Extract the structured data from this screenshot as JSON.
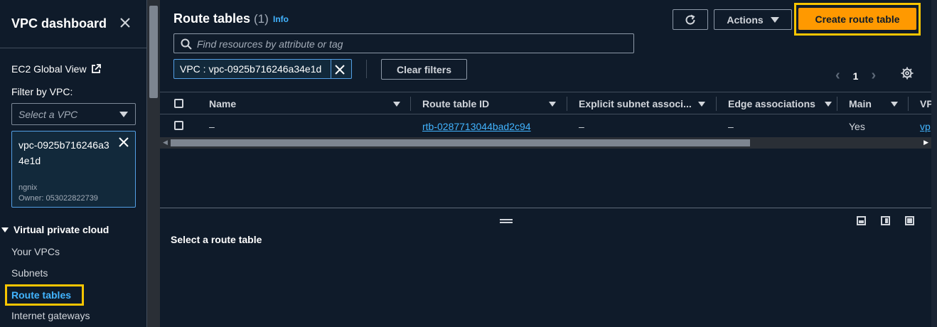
{
  "sidebar": {
    "title": "VPC dashboard",
    "ec2_global_view": "EC2 Global View",
    "filter_label": "Filter by VPC:",
    "select_placeholder": "Select a VPC",
    "selected_vpc": {
      "id": "vpc-0925b716246a34e1d",
      "name": "ngnix",
      "owner": "Owner: 053022822739"
    },
    "section": "Virtual private cloud",
    "items": [
      "Your VPCs",
      "Subnets",
      "Route tables",
      "Internet gateways"
    ],
    "active_item": "Route tables"
  },
  "header": {
    "title": "Route tables",
    "count": "(1)",
    "info": "Info",
    "actions_label": "Actions",
    "create_label": "Create route table"
  },
  "search": {
    "placeholder": "Find resources by attribute or tag"
  },
  "filter_token": "VPC : vpc-0925b716246a34e1d",
  "clear_filters": "Clear filters",
  "pagination": {
    "page": "1"
  },
  "table": {
    "columns": [
      "Name",
      "Route table ID",
      "Explicit subnet associ...",
      "Edge associations",
      "Main",
      "VP"
    ],
    "rows": [
      {
        "name": "–",
        "route_table_id": "rtb-0287713044bad2c94",
        "explicit_subnet": "–",
        "edge": "–",
        "main": "Yes",
        "vpc": "vp"
      }
    ]
  },
  "split_panel": {
    "title": "Select a route table"
  },
  "colors": {
    "accent": "#ff9900",
    "highlight": "#f8c500",
    "link": "#42b4ff",
    "background": "#0f1b2a"
  }
}
